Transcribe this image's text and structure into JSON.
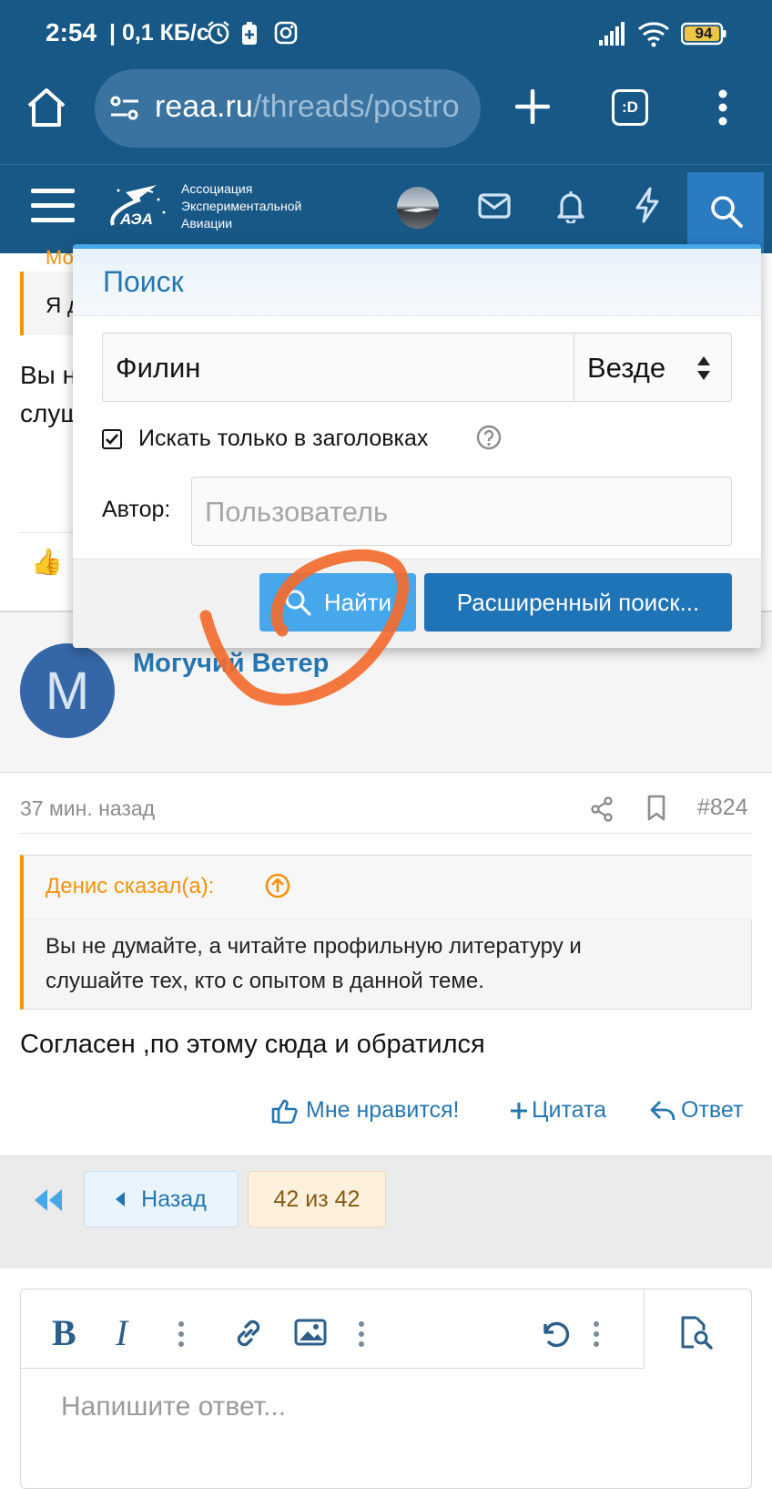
{
  "status_bar": {
    "time": "2:54",
    "net_speed": "| 0,1 КБ/с",
    "battery": "94"
  },
  "browser": {
    "url_domain": "reaa.ru",
    "url_path": "/threads/postro",
    "tabs_label": ":D"
  },
  "site_header": {
    "logo_text_line1": "Ассоциация",
    "logo_text_line2": "Экспериментальной",
    "logo_text_line3": "Авиации",
    "logo_mark": "АЭА"
  },
  "search_menu": {
    "title": "Поиск",
    "query_value": "Филин",
    "scope_selected": "Везде",
    "titles_only_label": "Искать только в заголовках",
    "author_label": "Автор:",
    "author_placeholder": "Пользователь",
    "search_button": "Найти",
    "advanced_button": "Расширенный поиск..."
  },
  "bg_post": {
    "author_fragment": "Мо",
    "quote_fragment": "Я д",
    "body_line1": "Вы н",
    "body_line2": "слуш"
  },
  "post": {
    "avatar_letter": "M",
    "avatar_color": "#3567a8",
    "author": "Могучий Ветер",
    "time": "37 мин. назад",
    "number": "#824",
    "quote_author": "Денис сказал(а):",
    "quote_line1": "Вы не думайте, а читайте профильную литературу и",
    "quote_line2": "слушайте тех, кто с опытом в данной теме.",
    "body": "Согласен ,по этому сюда и обратился",
    "like": "Мне нравится!",
    "quote_action": "Цитата",
    "reply_action": "Ответ"
  },
  "pagination": {
    "back": "Назад",
    "page_info": "42 из 42"
  },
  "editor": {
    "placeholder": "Напишите ответ..."
  },
  "colors": {
    "brand": "#185886",
    "accent": "#2577b1",
    "button_light": "#47a7eb",
    "quote_orange": "#f2930d",
    "annotation": "#f26b2e"
  }
}
